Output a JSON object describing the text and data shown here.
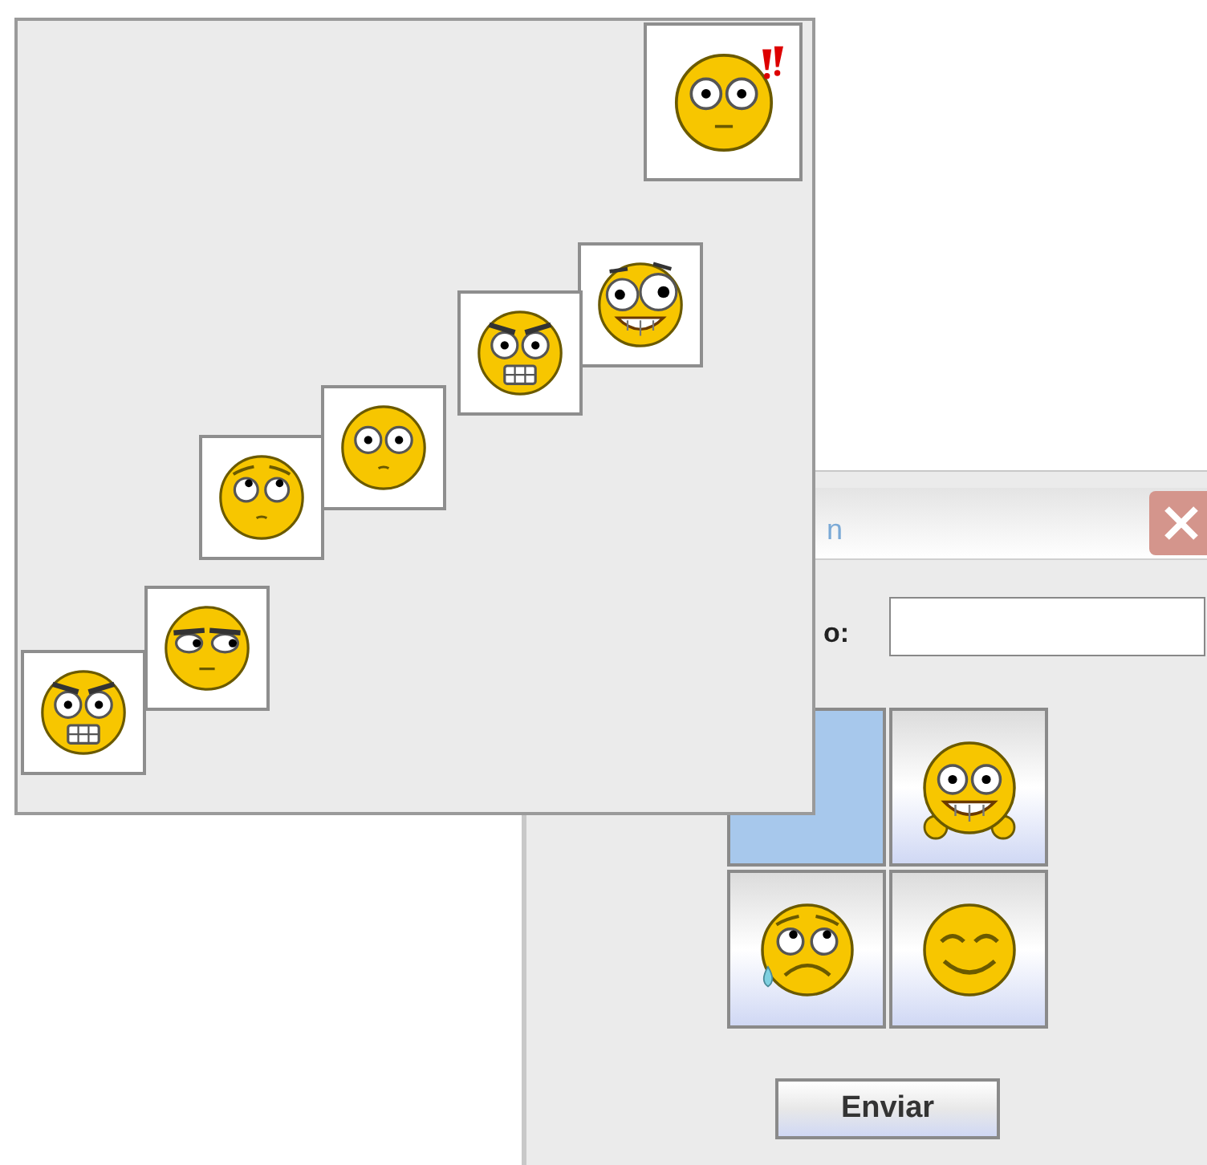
{
  "emoji_window": {
    "emojis": [
      {
        "kind": "shocked"
      },
      {
        "kind": "crazy"
      },
      {
        "kind": "angry-teeth"
      },
      {
        "kind": "staring"
      },
      {
        "kind": "worried"
      },
      {
        "kind": "sideways"
      },
      {
        "kind": "angry-grid"
      }
    ]
  },
  "dialog": {
    "title": "n",
    "field_label": "o:",
    "emoji_buttons": [
      {
        "kind": "blank",
        "selected": true
      },
      {
        "kind": "grin-hands",
        "selected": false
      },
      {
        "kind": "crying",
        "selected": false
      },
      {
        "kind": "happy",
        "selected": false
      }
    ],
    "send_button": "Enviar"
  }
}
